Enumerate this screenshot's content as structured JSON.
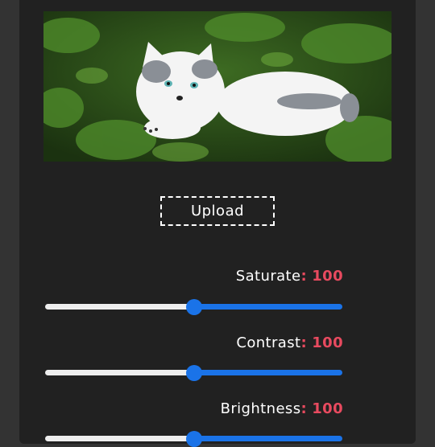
{
  "upload": {
    "label": "Upload"
  },
  "controls": [
    {
      "name": "Saturate",
      "separator": ":",
      "value": "100",
      "fraction": 0.5
    },
    {
      "name": "Contrast",
      "separator": ":",
      "value": "100",
      "fraction": 0.5
    },
    {
      "name": "Brightness",
      "separator": ":",
      "value": "100",
      "fraction": 0.5
    }
  ],
  "colors": {
    "panel": "#212121",
    "page": "#333333",
    "accent": "#1a73e8",
    "value": "#e84a5f"
  }
}
